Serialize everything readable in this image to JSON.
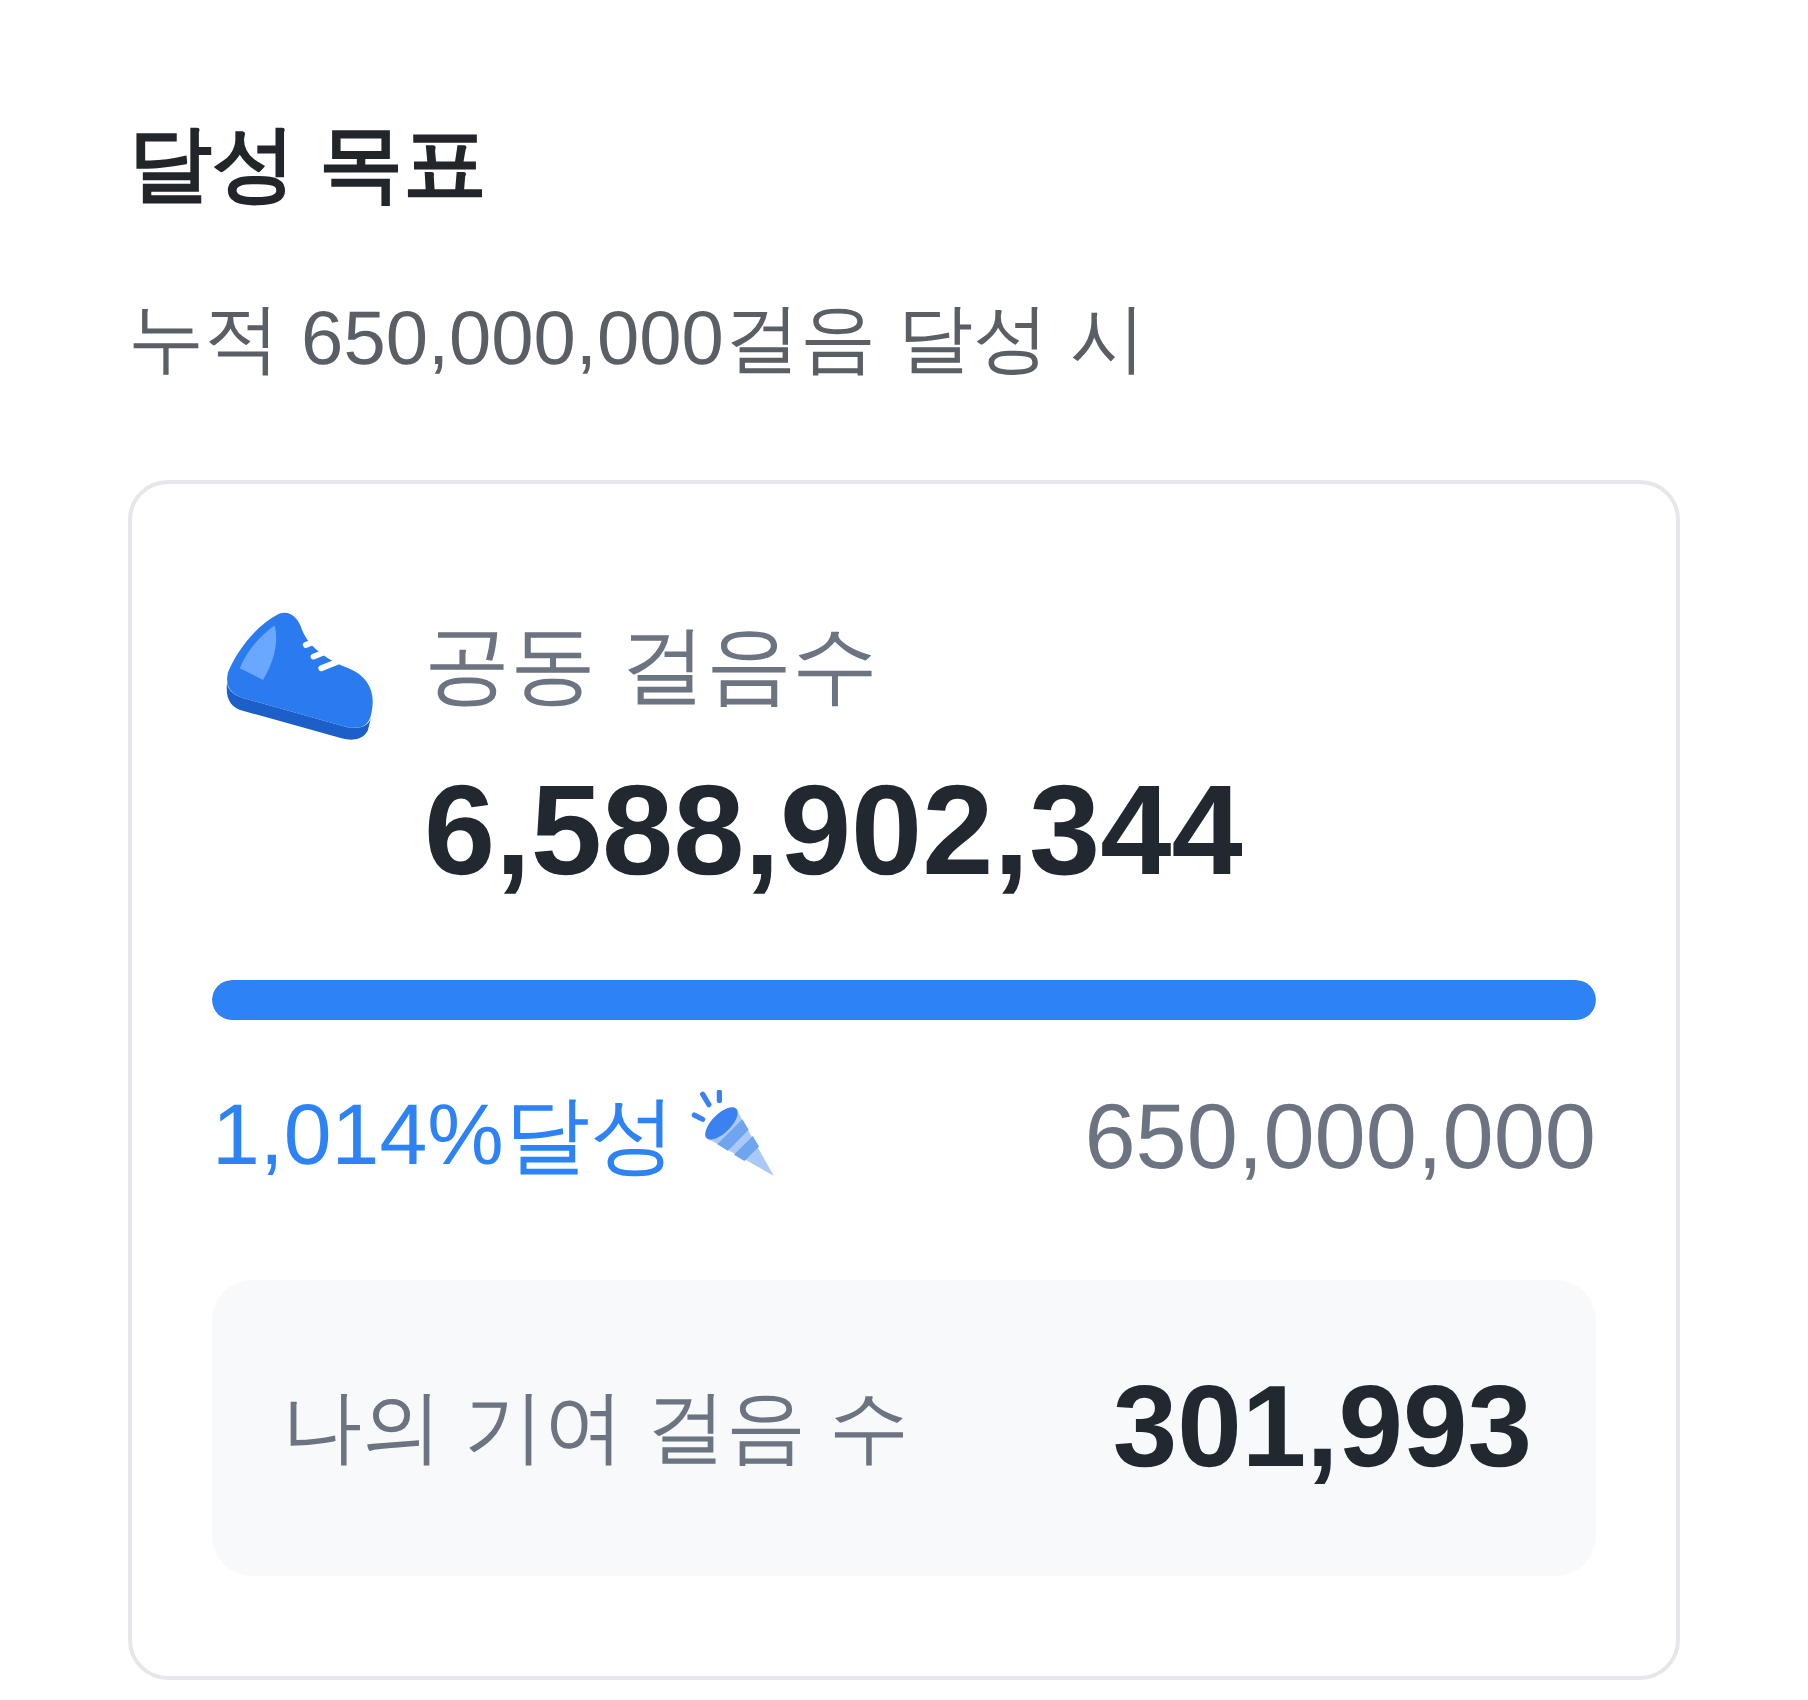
{
  "section": {
    "title": "달성 목표",
    "subtitle": "누적 650,000,000걸음 달성 시"
  },
  "card": {
    "label": "공동 걸음수",
    "total": "6,588,902,344",
    "progress": {
      "level": 1,
      "percent_text": "1,014%달성",
      "goal": "650,000,000"
    },
    "contribution": {
      "label": "나의 기여 걸음 수",
      "value": "301,993"
    }
  }
}
